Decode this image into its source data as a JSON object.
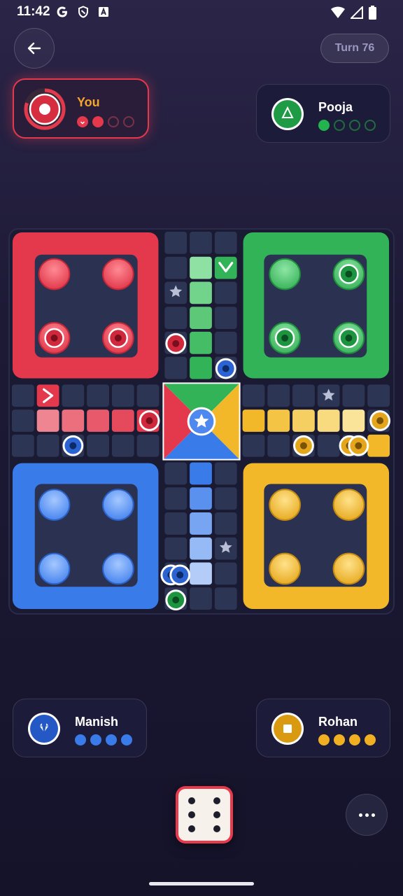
{
  "status": {
    "time": "11:42",
    "left_icons": [
      "google-g-icon",
      "shield-icon",
      "translate-a-icon"
    ],
    "right_icons": [
      "wifi-icon",
      "signal-icon",
      "battery-icon"
    ]
  },
  "header": {
    "back_icon": "arrow-left-icon",
    "turn_label": "Turn 76"
  },
  "players": {
    "you": {
      "name": "You",
      "color": "#e4394d",
      "symbol": "dot",
      "progress": 0.8,
      "pips": [
        "x-filled",
        "filled",
        "empty",
        "empty"
      ]
    },
    "pooja": {
      "name": "Pooja",
      "color": "#23b44f",
      "symbol": "triangle",
      "pips": [
        "filled",
        "empty",
        "empty",
        "empty"
      ]
    },
    "manish": {
      "name": "Manish",
      "color": "#2e6fe0",
      "symbol": "diamond",
      "pips": [
        "filled",
        "filled",
        "filled",
        "filled"
      ]
    },
    "rohan": {
      "name": "Rohan",
      "color": "#f0b021",
      "symbol": "square",
      "pips": [
        "filled",
        "filled",
        "filled",
        "filled"
      ]
    }
  },
  "board": {
    "colors": {
      "red": "#e4394d",
      "green": "#33b357",
      "blue": "#3a7bea",
      "yellow": "#f2b82a",
      "cell": "#2d3555"
    },
    "home_tokens": {
      "red": [
        "empty",
        "empty",
        "token",
        "token"
      ],
      "green": [
        "empty",
        "token",
        "token",
        "token"
      ],
      "blue": [
        "empty",
        "empty",
        "empty",
        "empty"
      ],
      "yellow": [
        "empty",
        "empty",
        "empty",
        "empty"
      ]
    }
  },
  "dice": {
    "value": 6,
    "border_color": "#e9394d"
  },
  "controls": {
    "more_icon": "more-horizontal-icon"
  }
}
